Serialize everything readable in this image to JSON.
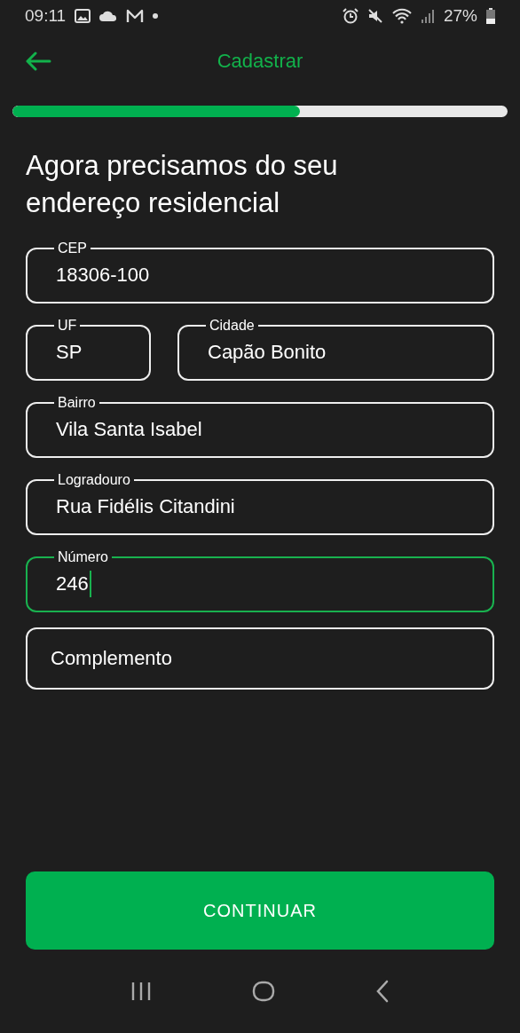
{
  "status_bar": {
    "time": "09:11",
    "battery_text": "27%"
  },
  "header": {
    "title": "Cadastrar"
  },
  "progress": {
    "level": 0.58
  },
  "heading": "Agora precisamos do seu endereço residencial",
  "form_rows": [
    [
      {
        "label": "CEP",
        "value": "18306-100",
        "focused": false
      }
    ],
    [
      {
        "label": "UF",
        "value": "SP",
        "focused": false
      },
      {
        "label": "Cidade",
        "value": "Capão Bonito",
        "focused": false
      }
    ],
    [
      {
        "label": "Bairro",
        "value": "Vila Santa Isabel",
        "focused": false
      }
    ],
    [
      {
        "label": "Logradouro",
        "value": "Rua Fidélis Citandini",
        "focused": false
      }
    ],
    [
      {
        "label": "Número",
        "value": "246",
        "focused": true
      }
    ],
    [
      {
        "placeholder": "Complemento",
        "focused": false
      }
    ]
  ],
  "button": "CONTINUAR"
}
